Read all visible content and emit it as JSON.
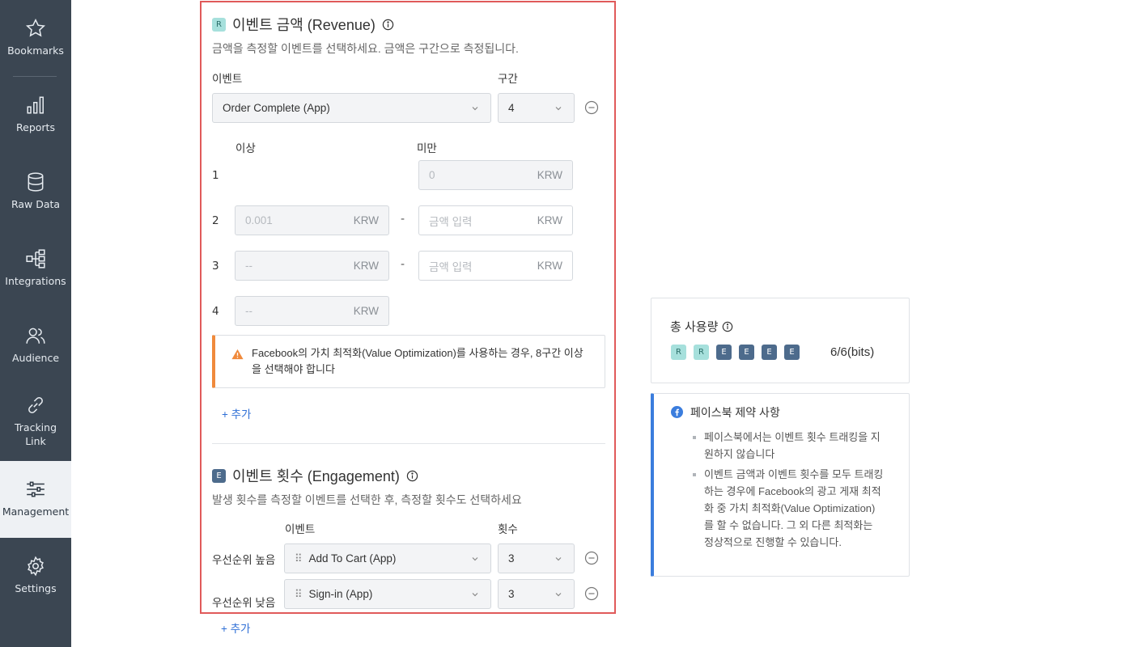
{
  "sidebar": {
    "items": [
      {
        "label": "Bookmarks",
        "icon": "star-icon"
      },
      {
        "label": "Reports",
        "icon": "bar-chart-icon"
      },
      {
        "label": "Raw Data",
        "icon": "database-icon"
      },
      {
        "label": "Integrations",
        "icon": "integrations-icon"
      },
      {
        "label": "Audience",
        "icon": "users-icon"
      },
      {
        "label": "Tracking Link",
        "icon": "link-icon"
      },
      {
        "label": "Management",
        "icon": "sliders-icon"
      },
      {
        "label": "Settings",
        "icon": "gear-icon"
      }
    ],
    "active": "Management"
  },
  "revenue": {
    "badge": "R",
    "title": "이벤트 금액 (Revenue)",
    "description": "금액을 측정할 이벤트를 선택하세요. 금액은 구간으로 측정됩니다.",
    "event_label": "이벤트",
    "segment_label": "구간",
    "event_value": "Order Complete (App)",
    "segment_value": "4",
    "min_label": "이상",
    "max_label": "미만",
    "rows": [
      {
        "num": "1",
        "min": "",
        "max": "0",
        "unit": "KRW"
      },
      {
        "num": "2",
        "min": "0.001",
        "max": "금액 입력",
        "unit": "KRW",
        "dash": "-"
      },
      {
        "num": "3",
        "min": "--",
        "max": "금액 입력",
        "unit": "KRW",
        "dash": "-"
      },
      {
        "num": "4",
        "min": "--",
        "max": "",
        "unit": "KRW"
      }
    ],
    "warning": "Facebook의 가치 최적화(Value Optimization)를 사용하는 경우, 8구간 이상을 선택해야 합니다",
    "add": "+ 추가"
  },
  "engagement": {
    "badge": "E",
    "title": "이벤트 횟수 (Engagement)",
    "description": "발생 횟수를 측정할 이벤트를 선택한 후, 측정할 횟수도 선택하세요",
    "event_label": "이벤트",
    "count_label": "횟수",
    "rows": [
      {
        "priority": "우선순위 높음",
        "event": "Add To Cart (App)",
        "count": "3"
      },
      {
        "priority": "우선순위 낮음",
        "event": "Sign-in (App)",
        "count": "3"
      }
    ],
    "add": "+ 추가"
  },
  "usage": {
    "title": "총 사용량",
    "badges": [
      "R",
      "R",
      "E",
      "E",
      "E",
      "E"
    ],
    "value": "6/6(bits)"
  },
  "facebook": {
    "title": "페이스북 제약 사항",
    "items": [
      "페이스북에서는 이벤트 횟수 트래킹을 지원하지 않습니다",
      "이벤트 금액과 이벤트 횟수를 모두 트래킹하는 경우에 Facebook의 광고 게재 최적화 중 가치 최적화(Value Optimization)를 할 수 없습니다. 그 외 다른 최적화는 정상적으로 진행할 수 있습니다."
    ]
  },
  "colors": {
    "sidebar_bg": "#3b4652",
    "panel_border": "#e05a5a",
    "warning_accent": "#f08a3c",
    "link": "#2f6fd6",
    "fb_accent": "#3b7ddd"
  }
}
